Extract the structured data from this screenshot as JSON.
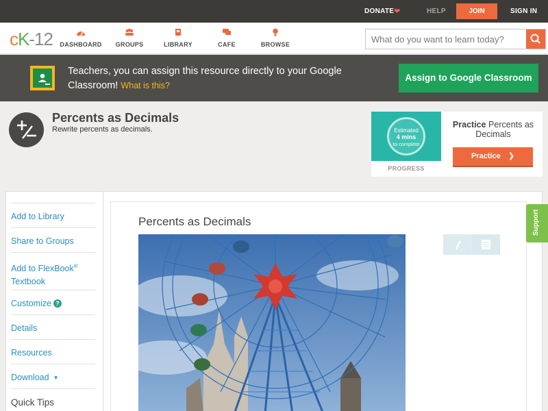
{
  "topbar": {
    "donate": "DONATE",
    "help": "HELP",
    "join": "JOIN",
    "signin": "SIGN IN"
  },
  "logo": {
    "c": "c",
    "k": "K",
    "dash": "-",
    "n": "12"
  },
  "nav": {
    "items": [
      {
        "label": "DASHBOARD",
        "icon": "dashboard-icon"
      },
      {
        "label": "GROUPS",
        "icon": "groups-icon"
      },
      {
        "label": "LIBRARY",
        "icon": "library-icon"
      },
      {
        "label": "CAFE",
        "icon": "cafe-icon"
      },
      {
        "label": "BROWSE",
        "icon": "browse-icon"
      }
    ]
  },
  "search": {
    "placeholder": "What do you want to learn today?"
  },
  "classroom": {
    "text": "Teachers, you can assign this resource directly to your Google Classroom!",
    "what": "What is this?",
    "assign": "Assign to Google Classroom"
  },
  "header": {
    "title": "Percents as Decimals",
    "subtitle": "Rewrite percents as decimals."
  },
  "practice": {
    "estimated": "Estimated",
    "mins": "4 mins",
    "complete": "to complete",
    "progress": "PROGRESS",
    "title_bold": "Practice",
    "title_rest": " Percents as Decimals",
    "button": "Practice"
  },
  "sidebar": {
    "add_library": "Add to Library",
    "share_groups": "Share to Groups",
    "add_flexbook_line1": "Add to FlexBook",
    "add_flexbook_reg": "®",
    "add_flexbook_line2": "Textbook",
    "customize": "Customize",
    "customize_help": "?",
    "details": "Details",
    "resources": "Resources",
    "download": "Download",
    "quick_tips": "Quick Tips"
  },
  "content": {
    "title": "Percents as Decimals"
  },
  "support": "Support",
  "colors": {
    "accent": "#ec6a3e",
    "green": "#1fa25a",
    "link": "#2c8ec0",
    "dark": "#3d3b38"
  }
}
